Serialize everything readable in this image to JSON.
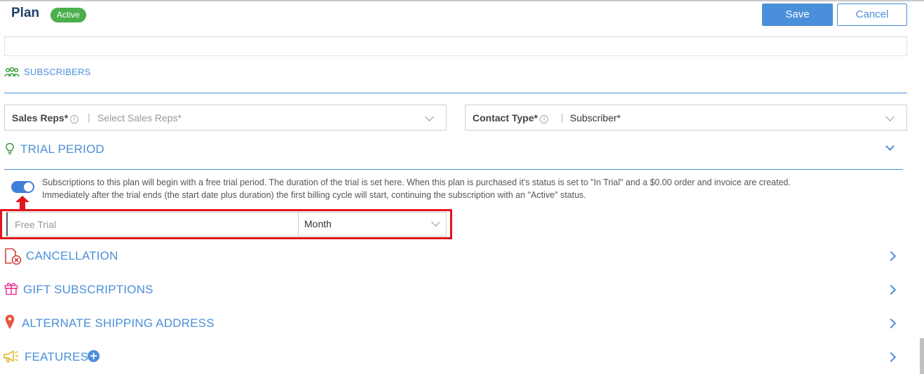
{
  "header": {
    "title": "Plan",
    "status_badge": "Active",
    "save_label": "Save",
    "cancel_label": "Cancel"
  },
  "subscribers": {
    "section_label": "SUBSCRIBERS",
    "sales_reps": {
      "label": "Sales Reps*",
      "info_icon": "ⓘ",
      "separator": "|",
      "placeholder": "Select Sales Reps*"
    },
    "contact_type": {
      "label": "Contact Type*",
      "info_icon": "ⓘ",
      "separator": "|",
      "value": "Subscriber*"
    }
  },
  "trial_period": {
    "title": "TRIAL PERIOD",
    "enabled": true,
    "description_line1": "Subscriptions to this plan will begin with a free trial period. The duration of the trial is set here. When this plan is purchased it's status is set to \"In Trial\" and a $0.00 order and invoice are created.",
    "description_line2": "Immediately after the trial ends (the start date plus duration) the first billing cycle will start, continuing the subscription with an \"Active\" status.",
    "duration_placeholder": "Free Trial",
    "duration_unit": "Month"
  },
  "sections": {
    "cancellation": "CANCELLATION",
    "gift_subscriptions": "GIFT SUBSCRIPTIONS",
    "alternate_shipping": "ALTERNATE SHIPPING ADDRESS",
    "features": "FEATURES",
    "features_add": "+"
  },
  "colors": {
    "accent": "#4a8fd9",
    "badge": "#4cae4c",
    "highlight": "#e4141b",
    "cancellation_icon": "#d0433b",
    "gift_icon": "#e83e9a",
    "pin_icon": "#e8553d",
    "megaphone_icon": "#e0b21f",
    "subscribers_icon": "#3c9a3c"
  },
  "icons": {
    "subscribers": "users-icon",
    "trial": "lightbulb-icon",
    "cancellation": "document-cancel-icon",
    "gift": "gift-icon",
    "shipping": "map-pin-icon",
    "features": "megaphone-icon"
  }
}
